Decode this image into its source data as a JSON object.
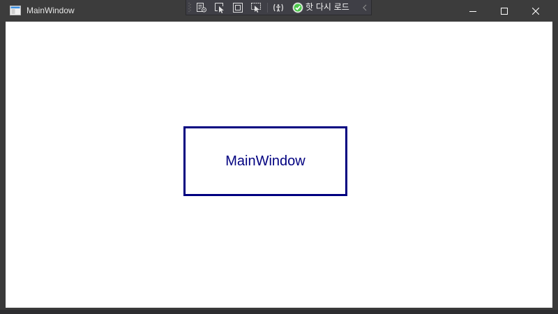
{
  "window": {
    "title": "MainWindow",
    "controls": {
      "minimize": "minimize",
      "maximize": "maximize",
      "close": "close"
    }
  },
  "runtime_toolbar": {
    "tools": [
      "select-element-tool",
      "selection-display-tool",
      "layout-adorners-tool",
      "track-focused-element-tool",
      "accessibility-tool"
    ],
    "hot_reload_label": "핫 다시 로드",
    "hot_reload_status": "ok",
    "collapse_icon": "chevron-left-icon"
  },
  "content": {
    "label_text": "MainWindow",
    "border_color": "#000080",
    "text_color": "#000080"
  },
  "colors": {
    "titlebar": "#3c3c3c",
    "client_background": "#ffffff",
    "hot_reload_ok": "#4ec94e"
  }
}
